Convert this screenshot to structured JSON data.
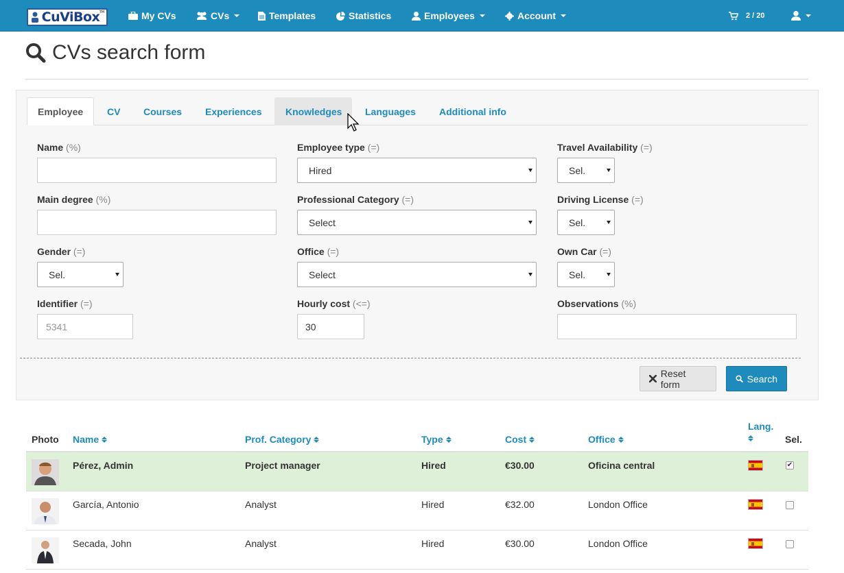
{
  "navbar": {
    "logo_text": "CuViBox",
    "logo_tm": "TM",
    "items": [
      {
        "label": "My CVs",
        "icon": "briefcase-icon"
      },
      {
        "label": "CVs",
        "icon": "users-icon"
      },
      {
        "label": "Templates",
        "icon": "file-icon"
      },
      {
        "label": "Statistics",
        "icon": "pie-chart-icon"
      },
      {
        "label": "Employees",
        "icon": "user-icon"
      },
      {
        "label": "Account",
        "icon": "gear-icon"
      }
    ],
    "cart_count": "2 / 20"
  },
  "page": {
    "title": "CVs search form"
  },
  "tabs": [
    "Employee",
    "CV",
    "Courses",
    "Experiences",
    "Knowledges",
    "Languages",
    "Additional info"
  ],
  "active_tab": "Employee",
  "form": {
    "name": {
      "label": "Name",
      "op": "(%)",
      "value": ""
    },
    "main_degree": {
      "label": "Main degree",
      "op": "(%)",
      "value": ""
    },
    "gender": {
      "label": "Gender",
      "op": "(=)",
      "value": "Sel."
    },
    "identifier": {
      "label": "Identifier",
      "op": "(=)",
      "placeholder": "5341"
    },
    "employee_type": {
      "label": "Employee type",
      "op": "(=)",
      "value": "Hired"
    },
    "professional_category": {
      "label": "Professional Category",
      "op": "(=)",
      "value": "Select"
    },
    "office": {
      "label": "Office",
      "op": "(=)",
      "value": "Select"
    },
    "hourly_cost": {
      "label": "Hourly cost",
      "op": "(<=)",
      "value": "30"
    },
    "travel_availability": {
      "label": "Travel Availability",
      "op": "(=)",
      "value": "Sel."
    },
    "driving_license": {
      "label": "Driving License",
      "op": "(=)",
      "value": "Sel."
    },
    "own_car": {
      "label": "Own Car",
      "op": "(=)",
      "value": "Sel."
    },
    "observations": {
      "label": "Observations",
      "op": "(%)",
      "value": ""
    },
    "reset_label": "Reset form",
    "search_label": "Search"
  },
  "table": {
    "headers": {
      "photo": "Photo",
      "name": "Name",
      "category": "Prof. Category",
      "type": "Type",
      "cost": "Cost",
      "office": "Office",
      "lang": "Lang.",
      "sel": "Sel."
    },
    "rows": [
      {
        "name": "Pérez, Admin",
        "category": "Project manager",
        "type": "Hired",
        "cost": "€30.00",
        "office": "Oficina central",
        "selected": true
      },
      {
        "name": "García, Antonio",
        "category": "Analyst",
        "type": "Hired",
        "cost": "€32.00",
        "office": "London Office",
        "selected": false
      },
      {
        "name": "Secada, John",
        "category": "Analyst",
        "type": "Hired",
        "cost": "€30.00",
        "office": "London Office",
        "selected": false
      }
    ]
  }
}
